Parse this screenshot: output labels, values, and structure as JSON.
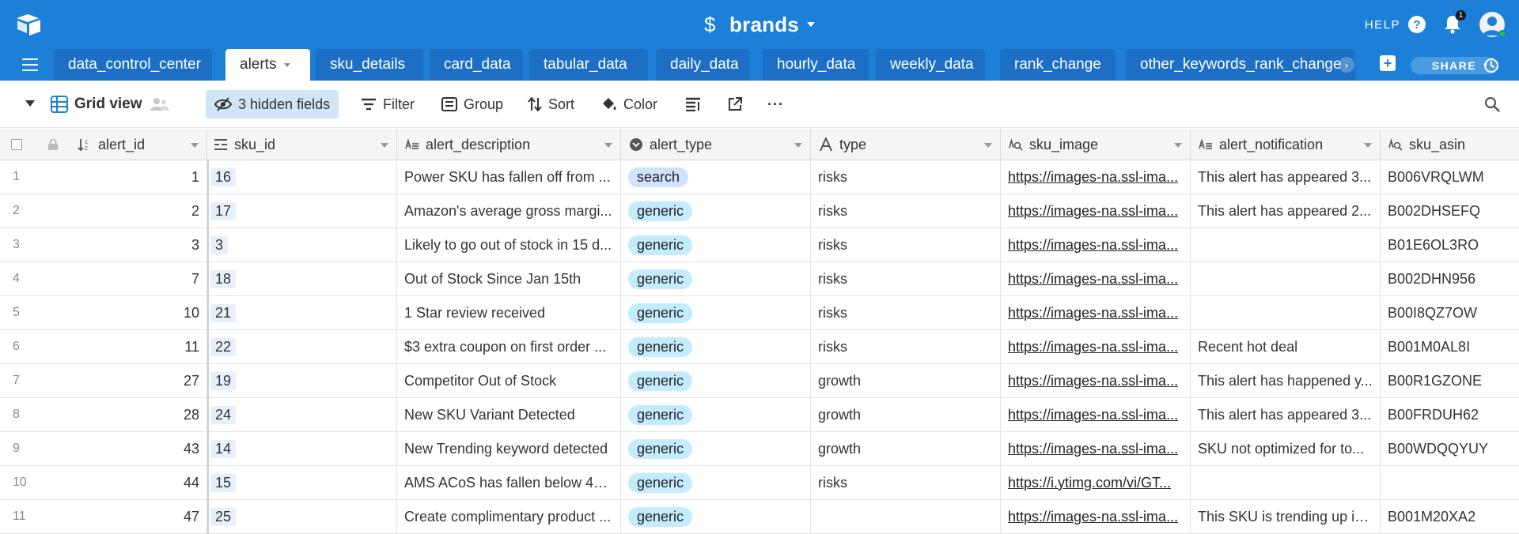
{
  "header": {
    "base_name": "brands",
    "help_label": "HELP",
    "help_glyph": "?",
    "notification_count": "1",
    "brand_color": "#1c7fd8"
  },
  "tabs": {
    "items": [
      {
        "label": "data_control_center"
      },
      {
        "label": "alerts",
        "active": true
      },
      {
        "label": "sku_details"
      },
      {
        "label": "card_data"
      },
      {
        "label": "tabular_data"
      },
      {
        "label": "daily_data"
      },
      {
        "label": "hourly_data"
      },
      {
        "label": "weekly_data"
      },
      {
        "label": "rank_change"
      },
      {
        "label": "other_keywords_rank_change"
      }
    ],
    "share_label": "SHARE",
    "add_glyph": "+",
    "scroll_glyph": "›"
  },
  "toolbar": {
    "view_name": "Grid view",
    "hidden_fields": "3 hidden fields",
    "filter": "Filter",
    "group": "Group",
    "sort": "Sort",
    "color": "Color",
    "more": "···"
  },
  "grid": {
    "columns": [
      {
        "label": "alert_id",
        "icon": "sort-number-icon"
      },
      {
        "label": "sku_id",
        "icon": "linked-record-icon"
      },
      {
        "label": "alert_description",
        "icon": "long-text-icon"
      },
      {
        "label": "alert_type",
        "icon": "single-select-icon"
      },
      {
        "label": "type",
        "icon": "single-line-text-icon"
      },
      {
        "label": "sku_image",
        "icon": "formula-text-icon"
      },
      {
        "label": "alert_notification",
        "icon": "long-text-icon"
      },
      {
        "label": "sku_asin",
        "icon": "formula-text-icon"
      }
    ],
    "rows": [
      {
        "n": "1",
        "alert_id": "1",
        "sku_id": "16",
        "desc": "Power SKU has fallen off from ...",
        "alert_type": "search",
        "type": "risks",
        "img": "https://images-na.ssl-ima...",
        "notif": "This alert has appeared 3...",
        "asin": "B006VRQLWM"
      },
      {
        "n": "2",
        "alert_id": "2",
        "sku_id": "17",
        "desc": "Amazon's average gross margi...",
        "alert_type": "generic",
        "type": "risks",
        "img": "https://images-na.ssl-ima...",
        "notif": "This alert has appeared 2...",
        "asin": "B002DHSEFQ"
      },
      {
        "n": "3",
        "alert_id": "3",
        "sku_id": "3",
        "desc": "Likely to go out of stock in 15 d...",
        "alert_type": "generic",
        "type": "risks",
        "img": "https://images-na.ssl-ima...",
        "notif": "",
        "asin": "B01E6OL3RO"
      },
      {
        "n": "4",
        "alert_id": "7",
        "sku_id": "18",
        "desc": "Out of Stock Since Jan 15th",
        "alert_type": "generic",
        "type": "risks",
        "img": "https://images-na.ssl-ima...",
        "notif": "",
        "asin": "B002DHN956"
      },
      {
        "n": "5",
        "alert_id": "10",
        "sku_id": "21",
        "desc": "1 Star review received",
        "alert_type": "generic",
        "type": "risks",
        "img": "https://images-na.ssl-ima...",
        "notif": "",
        "asin": "B00I8QZ7OW"
      },
      {
        "n": "6",
        "alert_id": "11",
        "sku_id": "22",
        "desc": "$3 extra coupon on first order ...",
        "alert_type": "generic",
        "type": "risks",
        "img": "https://images-na.ssl-ima...",
        "notif": "Recent hot deal",
        "asin": "B001M0AL8I"
      },
      {
        "n": "7",
        "alert_id": "27",
        "sku_id": "19",
        "desc": "Competitor Out of Stock",
        "alert_type": "generic",
        "type": "growth",
        "img": "https://images-na.ssl-ima...",
        "notif": "This alert has happened y...",
        "asin": "B00R1GZONE"
      },
      {
        "n": "8",
        "alert_id": "28",
        "sku_id": "24",
        "desc": "New SKU Variant Detected",
        "alert_type": "generic",
        "type": "growth",
        "img": "https://images-na.ssl-ima...",
        "notif": "This alert has appeared 3...",
        "asin": "B00FRDUH62"
      },
      {
        "n": "9",
        "alert_id": "43",
        "sku_id": "14",
        "desc": "New Trending keyword detected",
        "alert_type": "generic",
        "type": "growth",
        "img": "https://images-na.ssl-ima...",
        "notif": "SKU not optimized for to...",
        "asin": "B00WDQQYUY"
      },
      {
        "n": "10",
        "alert_id": "44",
        "sku_id": "15",
        "desc": "AMS ACoS has fallen below 40...",
        "alert_type": "generic",
        "type": "risks",
        "img": "https://i.ytimg.com/vi/GT...",
        "notif": "",
        "asin": ""
      },
      {
        "n": "11",
        "alert_id": "47",
        "sku_id": "25",
        "desc": "Create complimentary product ...",
        "alert_type": "generic",
        "type": "",
        "img": "https://images-na.ssl-ima...",
        "notif": "This SKU is trending up in...",
        "asin": "B001M20XA2"
      }
    ]
  }
}
